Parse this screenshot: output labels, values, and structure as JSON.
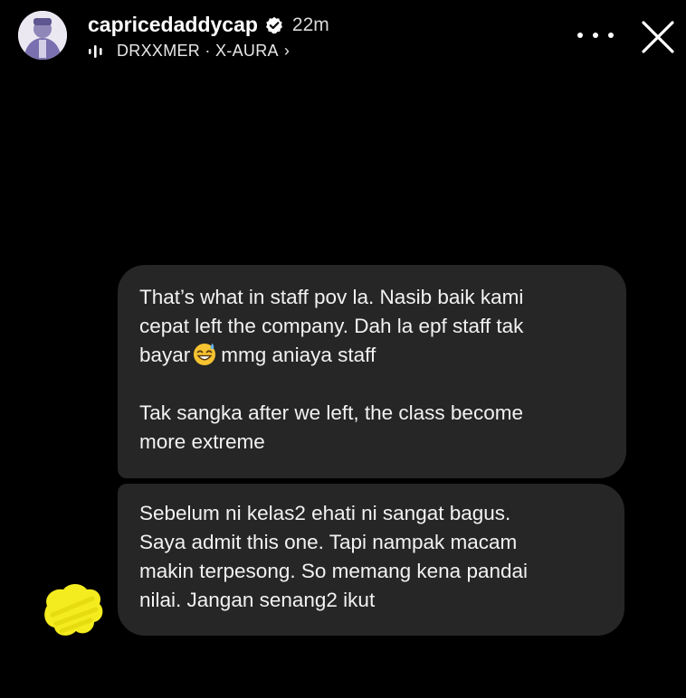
{
  "header": {
    "username": "capricedaddycap",
    "time": "22m",
    "music": "DRXXMER · X-AURA",
    "music_chevron": "›",
    "icons": {
      "avatar": "profile-avatar",
      "verified": "verified-badge-icon",
      "music": "audio-bars-icon",
      "more": "more-options-icon",
      "close": "close-icon"
    }
  },
  "messages": [
    {
      "lines": [
        "That’s what in staff pov la. Nasib baik kami",
        "cepat left the company. Dah la epf staff tak"
      ],
      "line3_before": "bayar",
      "line3_after": "mmg aniaya staff",
      "emoji": "sweat-smile-emoji",
      "paragraph2": [
        "Tak sangka after we left, the class become",
        "more extreme"
      ]
    },
    {
      "lines": [
        "Sebelum ni kelas2 ehati ni sangat bagus.",
        "Saya admit this one. Tapi nampak macam",
        "makin terpesong. So memang kena pandai",
        "nilai. Jangan senang2 ikut"
      ]
    }
  ],
  "colors": {
    "background": "#000000",
    "bubble": "#262626",
    "text": "#f2f2f2",
    "redaction": "#f4ec1e"
  }
}
